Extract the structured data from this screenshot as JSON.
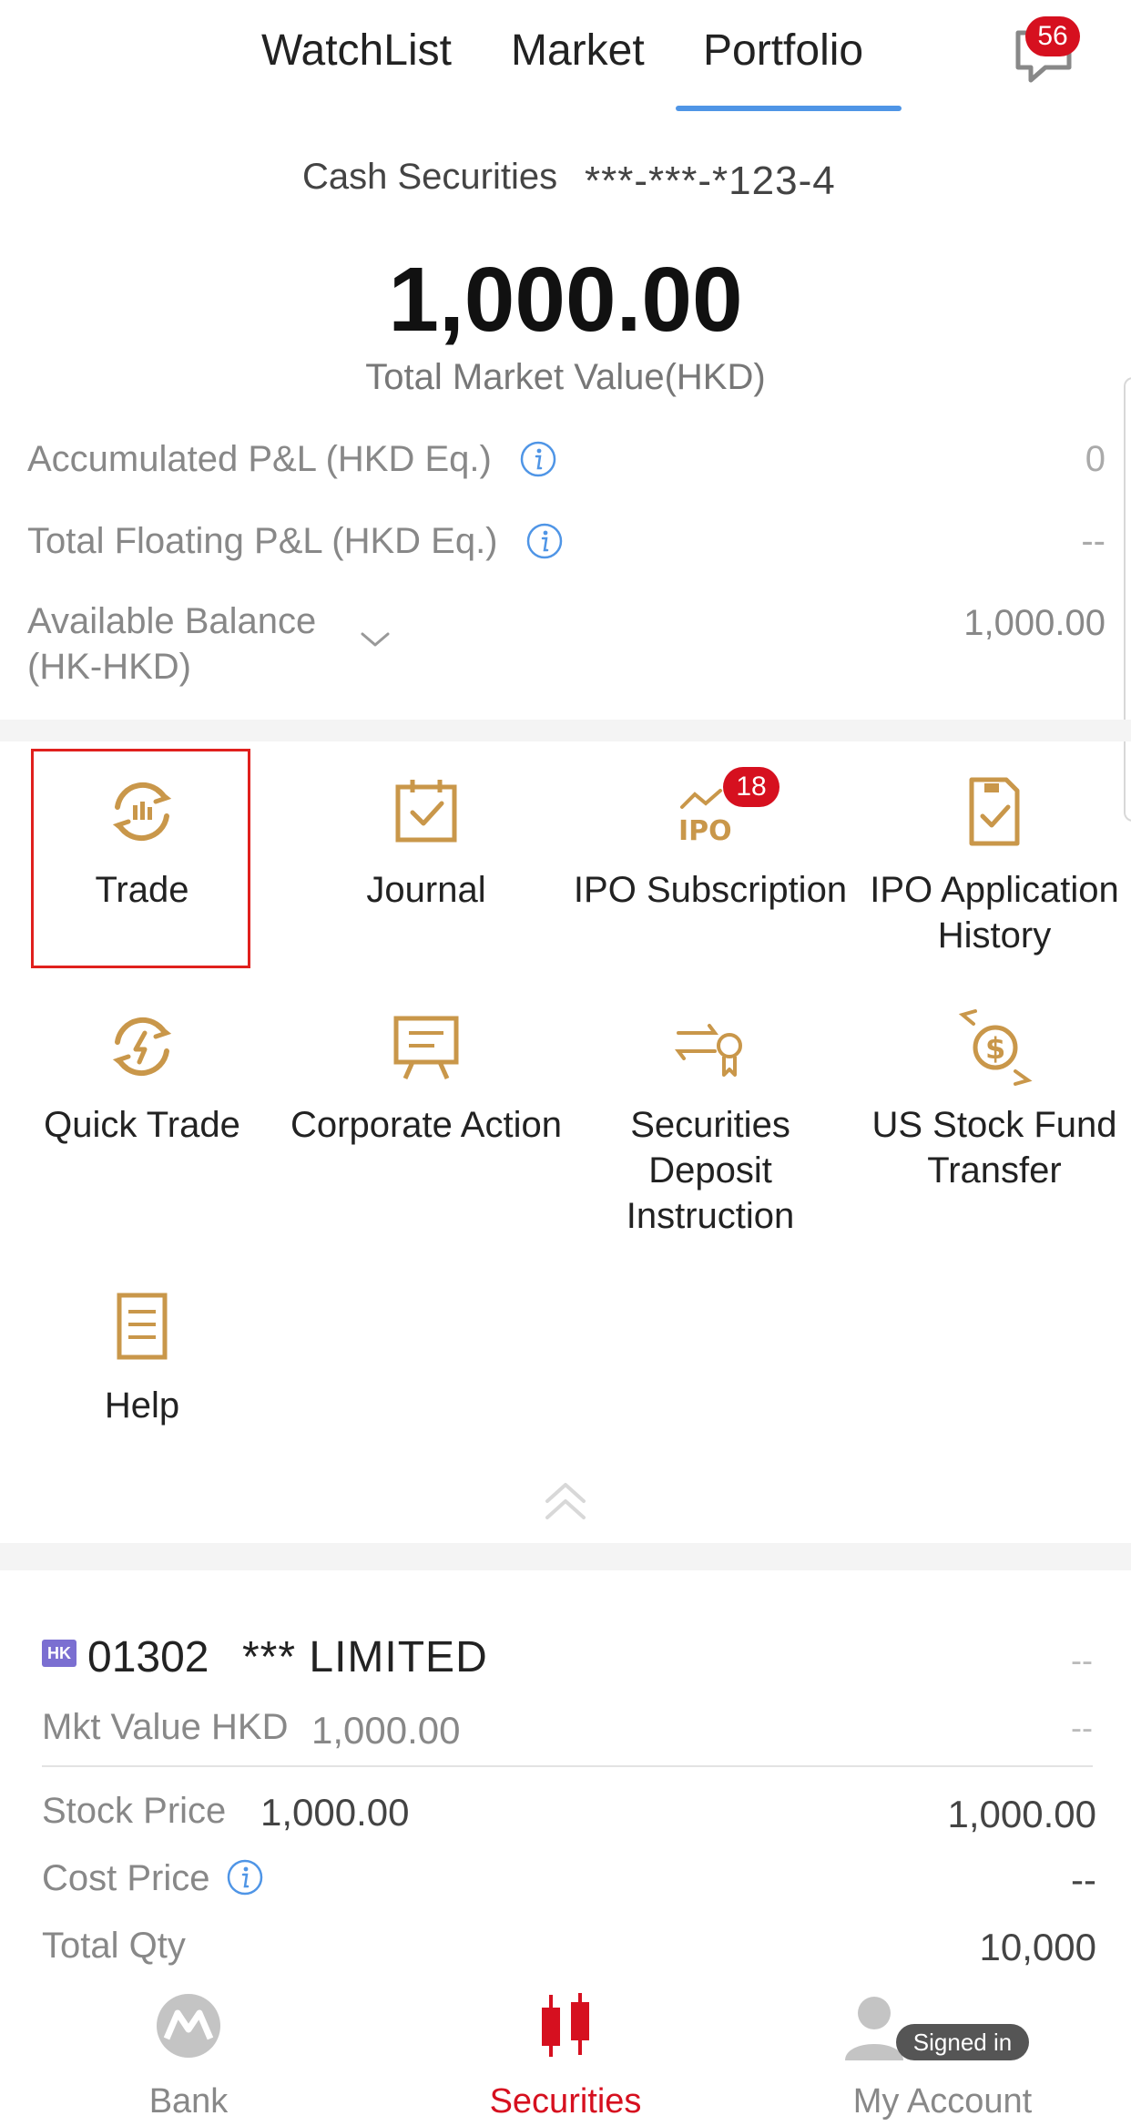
{
  "tabs": [
    {
      "label": "WatchList"
    },
    {
      "label": "Market"
    },
    {
      "label": "Portfolio",
      "active": true
    }
  ],
  "messages": {
    "count": "56",
    "icon": "chat-bubble-icon"
  },
  "account": {
    "type_label": "Cash Securities",
    "number": "***-***-*123-4",
    "total_value": "1,000.00",
    "total_label": "Total Market Value(HKD)"
  },
  "summary_rows": {
    "accumulated_pl": {
      "label": "Accumulated P&L (HKD Eq.)",
      "value": "0"
    },
    "floating_pl": {
      "label": "Total Floating P&L (HKD Eq.)",
      "value": "--"
    },
    "available_balance": {
      "label_line1": "Available Balance",
      "label_line2": "(HK-HKD)",
      "value": "1,000.00"
    }
  },
  "functions": [
    {
      "label": "Trade",
      "icon": "trade-cycle-icon"
    },
    {
      "label": "Journal",
      "icon": "journal-calendar-icon"
    },
    {
      "label": "IPO Subscription",
      "icon": "ipo-icon",
      "badge": "18"
    },
    {
      "label": "IPO Application History",
      "icon": "ipo-history-icon"
    },
    {
      "label": "Quick Trade",
      "icon": "quick-trade-icon"
    },
    {
      "label": "Corporate Action",
      "icon": "corporate-action-icon"
    },
    {
      "label": "Securities Deposit Instruction",
      "icon": "securities-deposit-icon"
    },
    {
      "label": "US Stock Fund Transfer",
      "icon": "fund-transfer-icon"
    },
    {
      "label": "Help",
      "icon": "help-document-icon"
    }
  ],
  "holding": {
    "market_tag": "HK",
    "code": "01302",
    "name": "*** LIMITED",
    "change_top": "--",
    "mkt_value_label": "Mkt Value HKD",
    "mkt_value": "1,000.00",
    "change_mkt": "--",
    "stock_price_label": "Stock Price",
    "stock_price": "1,000.00",
    "stock_price_right": "1,000.00",
    "cost_price_label": "Cost Price",
    "cost_price": "--",
    "total_qty_label": "Total Qty",
    "total_qty": "10,000"
  },
  "bottom_nav": [
    {
      "label": "Bank",
      "icon": "bank-logo-icon"
    },
    {
      "label": "Securities",
      "icon": "candlestick-icon",
      "active": true
    },
    {
      "label": "My Account",
      "icon": "user-avatar-icon",
      "badge": "Signed in"
    }
  ],
  "colors": {
    "accent_gold": "#c9974a",
    "tab_underline": "#4f95e6",
    "badge_red": "#d6101f",
    "active_red": "#d6101f",
    "highlight_red": "#e0201d"
  }
}
